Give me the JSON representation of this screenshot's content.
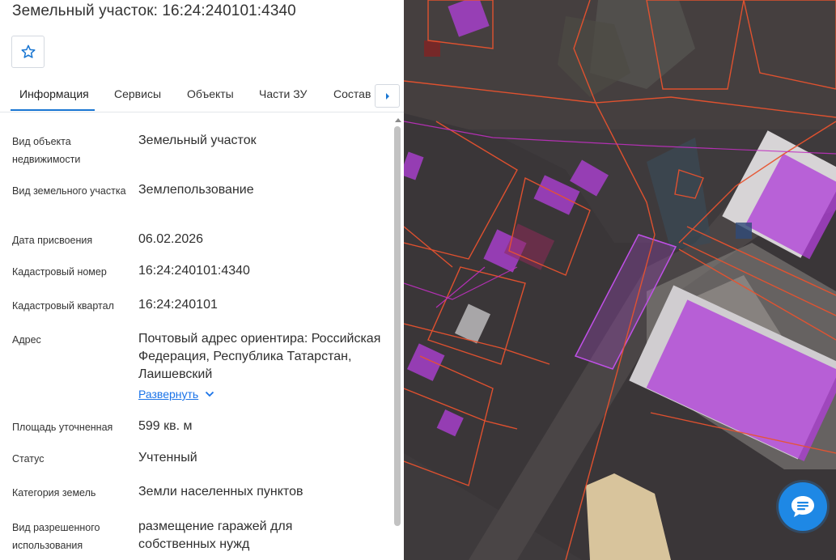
{
  "header": {
    "title": "Земельный участок: 16:24:240101:4340"
  },
  "favorite": {
    "icon": "star-outline-icon"
  },
  "tabs": [
    {
      "label": "Информация",
      "active": true
    },
    {
      "label": "Сервисы"
    },
    {
      "label": "Объекты"
    },
    {
      "label": "Части ЗУ"
    },
    {
      "label": "Состав"
    }
  ],
  "info": {
    "rows": [
      {
        "label": "Вид объекта недвижимости",
        "value": "Земельный участок"
      },
      {
        "label": "Вид земельного участка",
        "value": "Землепользование"
      },
      {
        "label": "Дата присвоения",
        "value": "06.02.2026"
      },
      {
        "label": "Кадастровый номер",
        "value": "16:24:240101:4340"
      },
      {
        "label": "Кадастровый квартал",
        "value": "16:24:240101"
      },
      {
        "label": "Адрес",
        "value": "Почтовый адрес ориентира: Российская Федерация, Республика Татарстан, Лаишевский"
      },
      {
        "label": "Площадь уточненная",
        "value": "599 кв. м"
      },
      {
        "label": "Статус",
        "value": "Учтенный"
      },
      {
        "label": "Категория земель",
        "value": "Земли населенных пунктов"
      },
      {
        "label": "Вид разрешенного использования",
        "value": "размещение гаражей для собственных нужд"
      }
    ],
    "expand_label": "Развернуть"
  },
  "map": {
    "parcel_line_color": "#e8532f",
    "building_fill_color": "#b040d8",
    "highlight_color": "#c050e8"
  },
  "chat": {
    "icon": "chat-bubble-icon",
    "color": "#1e88e5"
  }
}
